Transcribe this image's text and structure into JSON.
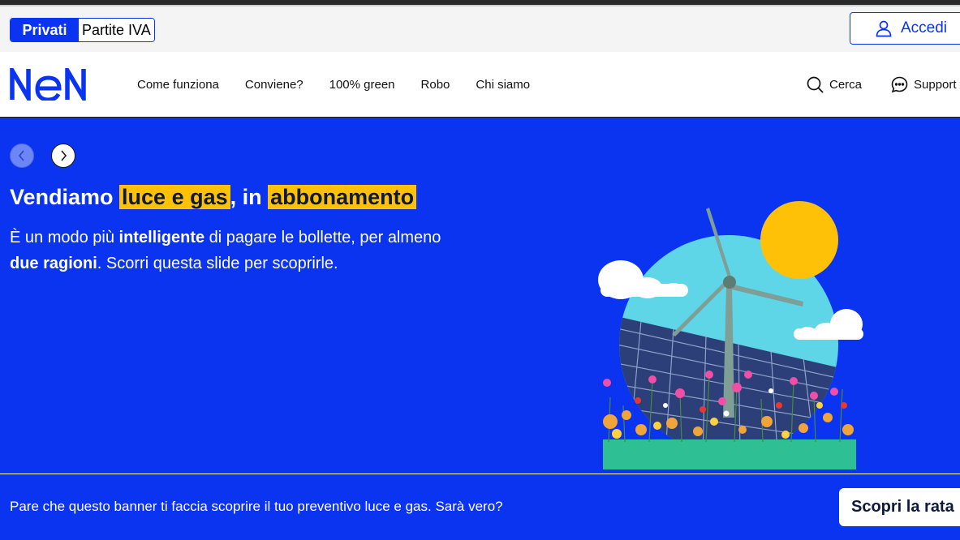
{
  "segment": {
    "options": [
      "Privati",
      "Partite IVA"
    ],
    "active": "Privati"
  },
  "login": {
    "label": "Accedi",
    "icon": "user-icon"
  },
  "brand": {
    "logo_text": "NeN",
    "color": "#0a34ef"
  },
  "nav": {
    "links": [
      "Come funziona",
      "Conviene?",
      "100% green",
      "Robo",
      "Chi siamo"
    ],
    "search_label": "Cerca",
    "support_label": "Support"
  },
  "hero": {
    "headline": {
      "part1": "Vendiamo ",
      "highlight1": "luce e gas",
      "part2": ", in ",
      "highlight2": "abbonamento"
    },
    "paragraph": {
      "t1": "È un modo più ",
      "b1": "intelligente",
      "t2": " di pagare le bollette, per almeno ",
      "b2": "due ragioni",
      "t3": ". Scorri questa slide per scoprirle."
    },
    "background_color": "#0a34ef",
    "highlight_color": "#ffc107"
  },
  "banner": {
    "text": "Pare che questo banner ti faccia scoprire il tuo preventivo luce e gas. Sarà vero?",
    "cta_label": "Scopri la rata"
  }
}
